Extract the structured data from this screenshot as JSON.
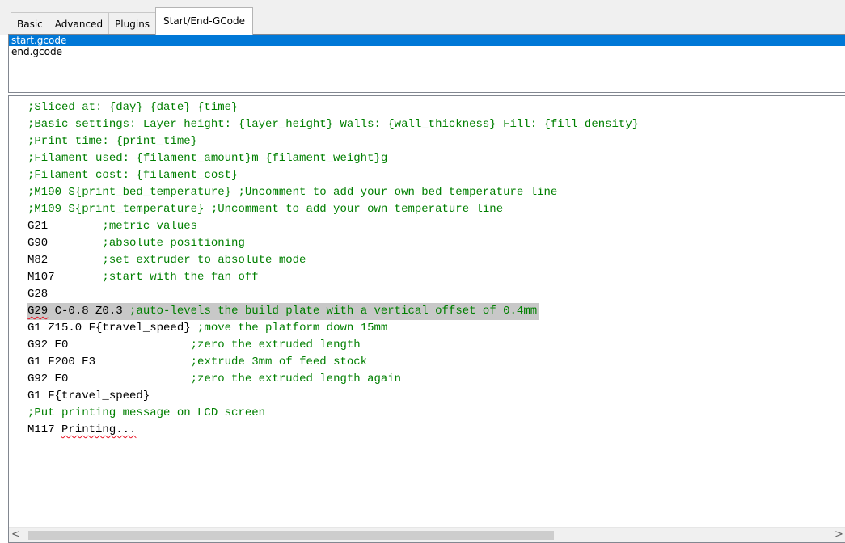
{
  "tabs": [
    {
      "label": "Basic"
    },
    {
      "label": "Advanced"
    },
    {
      "label": "Plugins"
    },
    {
      "label": "Start/End-GCode",
      "active": true
    }
  ],
  "files": [
    {
      "label": "start.gcode",
      "selected": true
    },
    {
      "label": "end.gcode",
      "selected": false
    }
  ],
  "editor": {
    "lines": [
      {
        "code": "",
        "comment": ";Sliced at: {day} {date} {time}"
      },
      {
        "code": "",
        "comment": ";Basic settings: Layer height: {layer_height} Walls: {wall_thickness} Fill: {fill_density}"
      },
      {
        "code": "",
        "comment": ";Print time: {print_time}"
      },
      {
        "code": "",
        "comment": ";Filament used: {filament_amount}m {filament_weight}g"
      },
      {
        "code": "",
        "comment": ";Filament cost: {filament_cost}"
      },
      {
        "code": "",
        "comment": ";M190 S{print_bed_temperature} ;Uncomment to add your own bed temperature line"
      },
      {
        "code": "",
        "comment": ";M109 S{print_temperature} ;Uncomment to add your own temperature line"
      },
      {
        "code": "G21        ",
        "comment": ";metric values"
      },
      {
        "code": "G90        ",
        "comment": ";absolute positioning"
      },
      {
        "code": "M82        ",
        "comment": ";set extruder to absolute mode"
      },
      {
        "code": "M107       ",
        "comment": ";start with the fan off"
      },
      {
        "code": "G28",
        "comment": ""
      },
      {
        "code": "G29 C-0.8 Z0.3 ",
        "comment": ";auto-levels the build plate with a vertical offset of 0.4mm",
        "highlighted": true
      },
      {
        "code": "G1 Z15.0 F{travel_speed} ",
        "comment": ";move the platform down 15mm"
      },
      {
        "code": "G92 E0                  ",
        "comment": ";zero the extruded length"
      },
      {
        "code": "G1 F200 E3              ",
        "comment": ";extrude 3mm of feed stock"
      },
      {
        "code": "G92 E0                  ",
        "comment": ";zero the extruded length again"
      },
      {
        "code": "G1 F{travel_speed}",
        "comment": ""
      },
      {
        "code": "",
        "comment": ";Put printing message on LCD screen"
      },
      {
        "code": "M117 Printing...",
        "comment": ""
      }
    ]
  },
  "scrollbar": {
    "left_arrow": "<",
    "right_arrow": ">"
  }
}
